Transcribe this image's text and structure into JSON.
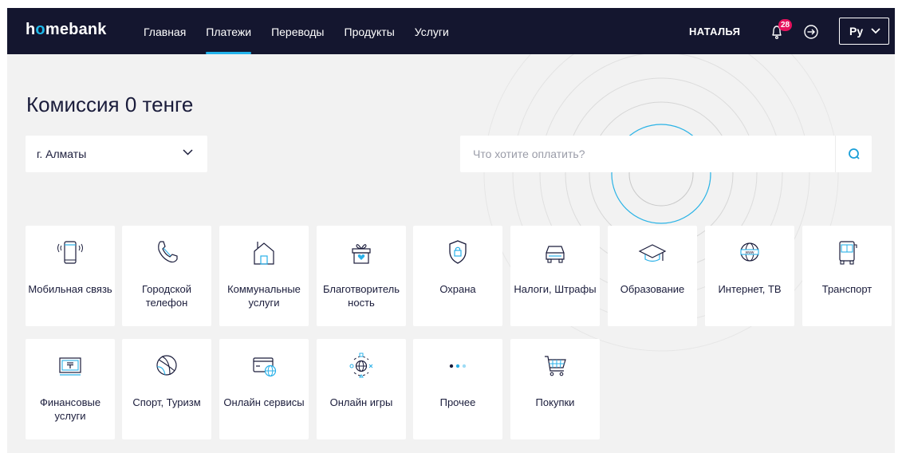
{
  "nav": {
    "logo_prefix": "h",
    "logo_accent": "o",
    "logo_suffix": "mebank",
    "menu": [
      {
        "label": "Главная",
        "active": false
      },
      {
        "label": "Платежи",
        "active": true
      },
      {
        "label": "Переводы",
        "active": false
      },
      {
        "label": "Продукты",
        "active": false
      },
      {
        "label": "Услуги",
        "active": false
      }
    ],
    "user_name": "НАТАЛЬЯ",
    "notifications_count": "28",
    "language": "Ру"
  },
  "page": {
    "title": "Комиссия 0 тенге",
    "city": "г. Алматы",
    "search_placeholder": "Что хотите оплатить?"
  },
  "categories": [
    {
      "label": "Мобильная связь",
      "icon": "mobile-icon"
    },
    {
      "label": "Городской телефон",
      "icon": "phone-handset-icon"
    },
    {
      "label": "Коммунальные услуги",
      "icon": "house-icon"
    },
    {
      "label": "Благотворитель ность",
      "icon": "gift-heart-icon"
    },
    {
      "label": "Охрана",
      "icon": "shield-lock-icon"
    },
    {
      "label": "Налоги, Штрафы",
      "icon": "car-icon"
    },
    {
      "label": "Образование",
      "icon": "graduation-cap-icon"
    },
    {
      "label": "Интернет, ТВ",
      "icon": "globe-www-icon"
    },
    {
      "label": "Транспорт",
      "icon": "bus-icon"
    },
    {
      "label": "Финансовые услуги",
      "icon": "banknote-tenge-icon"
    },
    {
      "label": "Спорт, Туризм",
      "icon": "ball-icon"
    },
    {
      "label": "Онлайн сервисы",
      "icon": "card-globe-icon"
    },
    {
      "label": "Онлайн игры",
      "icon": "gamepad-globe-icon"
    },
    {
      "label": "Прочее",
      "icon": "dots-icon"
    },
    {
      "label": "Покупки",
      "icon": "shopping-cart-icon"
    }
  ],
  "colors": {
    "nav_bg": "#14162f",
    "accent": "#23b4ec",
    "badge": "#e6115d",
    "page_bg": "#f2f2f2"
  }
}
